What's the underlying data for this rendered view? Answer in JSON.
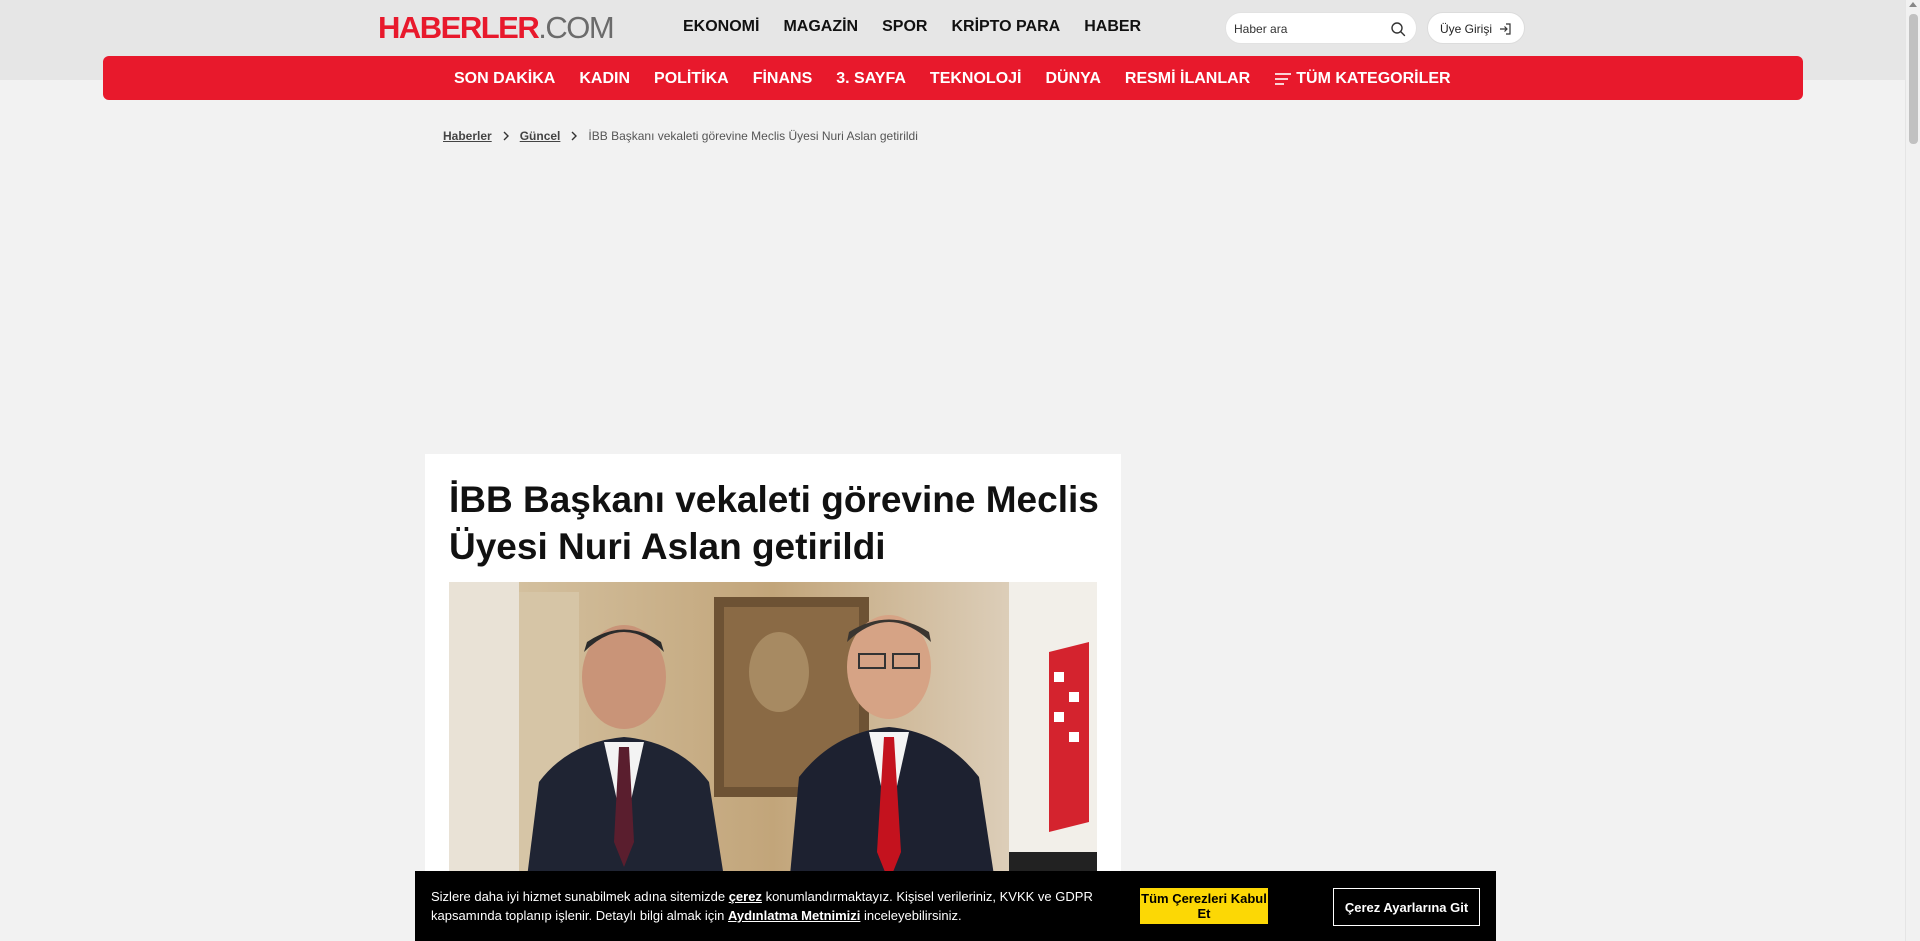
{
  "header": {
    "logo_main": "HABERLER",
    "logo_suffix": ".COM",
    "nav": [
      "EKONOMİ",
      "MAGAZİN",
      "SPOR",
      "KRİPTO PARA",
      "HABER"
    ],
    "search_placeholder": "Haber ara",
    "login_label": "Üye Girişi"
  },
  "categories": {
    "items": [
      "SON DAKİKA",
      "KADIN",
      "POLİTİKA",
      "FİNANS",
      "3. SAYFA",
      "TEKNOLOJİ",
      "DÜNYA",
      "RESMİ İLANLAR"
    ],
    "all_label": "TÜM KATEGORİLER"
  },
  "breadcrumb": {
    "home": "Haberler",
    "section": "Güncel",
    "current": "İBB Başkanı vekaleti görevine Meclis Üyesi Nuri Aslan getirildi"
  },
  "article": {
    "title": "İBB Başkanı vekaleti görevine Meclis Üyesi Nuri Aslan getirildi"
  },
  "cookie": {
    "text_1": "Sizlere daha iyi hizmet sunabilmek adına sitemizde ",
    "link_1": "çerez",
    "text_2": " konumlandırmaktayız. Kişisel verileriniz, KVKK ve GDPR kapsamında toplanıp işlenir. Detaylı bilgi almak için ",
    "link_2": "Aydınlatma Metnimizi",
    "text_3": " inceleyebilirsiniz.",
    "accept_label": "Tüm Çerezleri Kabul Et",
    "settings_label": "Çerez Ayarlarına Git"
  },
  "colors": {
    "brand_red": "#e8192c",
    "accept_yellow": "#fcd805"
  },
  "icons": [
    "search-icon",
    "login-icon",
    "menu-icon",
    "chevron-right-icon"
  ]
}
